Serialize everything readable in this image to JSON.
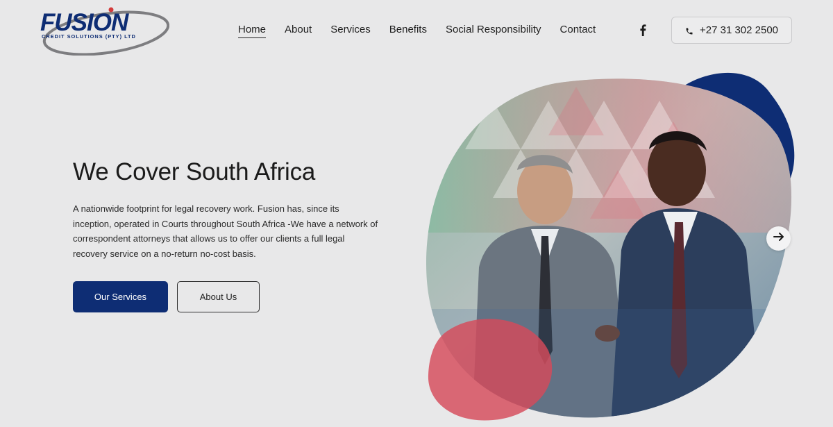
{
  "brand": {
    "name": "FUSION",
    "tagline": "CREDIT SOLUTIONS (PTY) LTD",
    "primary_color": "#0e2d74",
    "accent_red": "#d64a5a"
  },
  "nav": {
    "items": [
      {
        "label": "Home",
        "active": true
      },
      {
        "label": "About",
        "active": false
      },
      {
        "label": "Services",
        "active": false
      },
      {
        "label": "Benefits",
        "active": false
      },
      {
        "label": "Social Responsibility",
        "active": false
      },
      {
        "label": "Contact",
        "active": false
      }
    ],
    "social_icon": "facebook-icon",
    "phone": "+27 31 302 2500",
    "phone_icon": "phone-icon"
  },
  "hero": {
    "title": "We Cover South Africa",
    "text": "A nationwide footprint for legal recovery work. Fusion has, since its inception, operated in Courts throughout South Africa -We have a network of correspondent attorneys that allows us to offer our clients a full legal recovery service on a no-return no-cost basis.",
    "primary_button": "Our Services",
    "secondary_button": "About Us",
    "next_icon": "arrow-right-icon",
    "image_subject": "two businessmen walking"
  }
}
